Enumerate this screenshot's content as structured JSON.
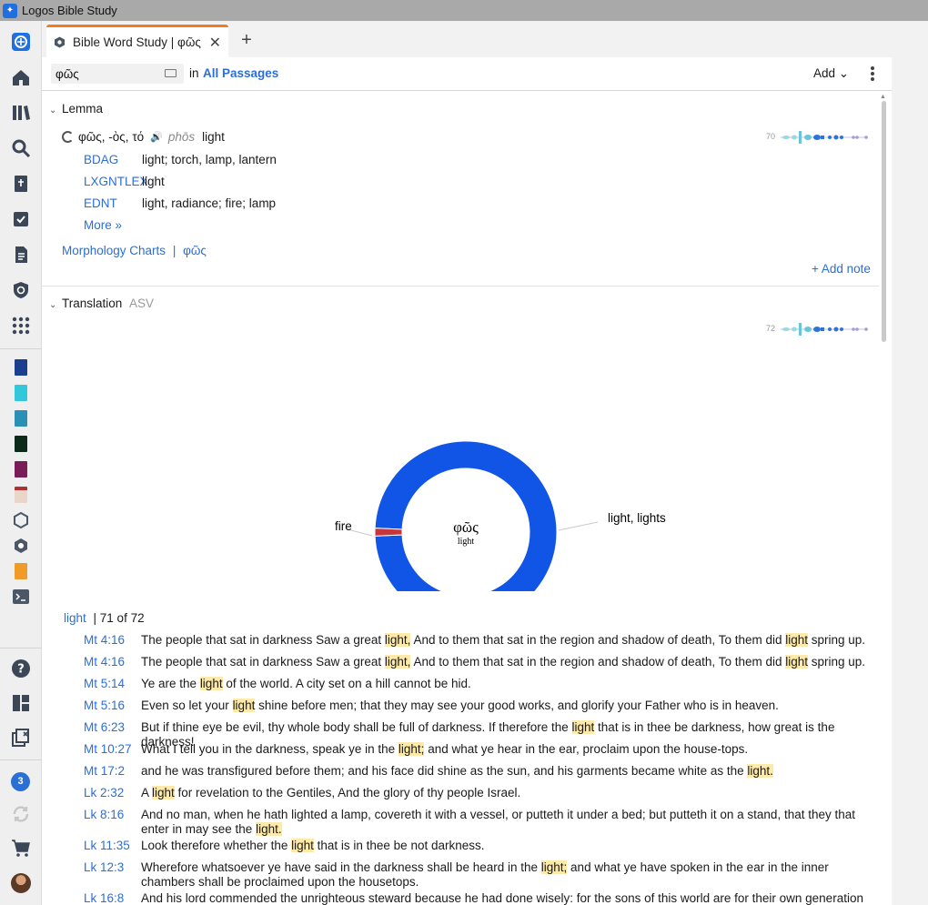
{
  "window": {
    "title": "Logos Bible Study"
  },
  "tabs": [
    {
      "label": "Bible Word Study | φῶς",
      "close": "✕"
    }
  ],
  "new_tab": "+",
  "toolbar": {
    "search_value": "φῶς",
    "in_label": "in",
    "passages_link": "All Passages",
    "add_label": "Add ⌄"
  },
  "lemma_section": {
    "title": "Lemma",
    "lemma": "φῶς, -ὸς, τό",
    "transliteration": "phōs",
    "gloss": "light",
    "sparkline_count": "70",
    "lexicons": [
      {
        "abbr": "BDAG",
        "def": "light; torch, lamp, lantern"
      },
      {
        "abbr": "LXGNTLEX",
        "def": "light"
      },
      {
        "abbr": "EDNT",
        "def": "light, radiance; fire; lamp"
      }
    ],
    "more_link": "More »",
    "morph_link": "Morphology Charts",
    "morph_sep": "|",
    "morph_word": "φῶς",
    "add_note": "+ Add note"
  },
  "translation_section": {
    "title": "Translation",
    "version": "ASV",
    "sparkline_count": "72"
  },
  "chart_data": {
    "type": "pie",
    "style": "donut",
    "center_label": "φῶς",
    "center_sublabel": "light",
    "slices": [
      {
        "label": "light, lights",
        "value": 71,
        "color": "#1055e6"
      },
      {
        "label": "fire",
        "value": 1,
        "color": "#c7363b"
      }
    ]
  },
  "results": {
    "term": "light",
    "count_text": "| 71 of 72",
    "verses": [
      {
        "ref": "Mt 4:16",
        "parts": [
          "The people that sat in darkness Saw a great ",
          "light,",
          " And to them that sat in the region and shadow of death, To them did ",
          "light",
          " spring up."
        ]
      },
      {
        "ref": "Mt 4:16",
        "parts": [
          "The people that sat in darkness Saw a great ",
          "light,",
          " And to them that sat in the region and shadow of death, To them did ",
          "light",
          " spring up."
        ]
      },
      {
        "ref": "Mt 5:14",
        "parts": [
          "Ye are the ",
          "light",
          " of the world. A city set on a hill cannot be hid."
        ]
      },
      {
        "ref": "Mt 5:16",
        "parts": [
          "Even so let your ",
          "light",
          " shine before men; that they may see your good works, and glorify your Father who is in heaven."
        ]
      },
      {
        "ref": "Mt 6:23",
        "parts": [
          "But if thine eye be evil, thy whole body shall be full of darkness. If therefore the ",
          "light",
          " that is in thee be darkness, how great is the darkness!"
        ]
      },
      {
        "ref": "Mt 10:27",
        "parts": [
          "What I tell you in the darkness, speak ye in the ",
          "light;",
          " and what ye hear in the ear, proclaim upon the house-tops."
        ]
      },
      {
        "ref": "Mt 17:2",
        "parts": [
          "and he was transfigured before them; and his face did shine as the sun, and his garments became white as the ",
          "light."
        ]
      },
      {
        "ref": "Lk 2:32",
        "parts": [
          "A ",
          "light",
          " for revelation to the Gentiles, And the glory of thy people Israel."
        ]
      },
      {
        "ref": "Lk 8:16",
        "parts": [
          "And no man, when he hath lighted a lamp, covereth it with a vessel, or putteth it under a bed; but putteth it on a stand, that they that enter in may see the ",
          "light."
        ]
      },
      {
        "ref": "Lk 11:35",
        "parts": [
          "Look therefore whether the ",
          "light",
          " that is in thee be not darkness."
        ]
      },
      {
        "ref": "Lk 12:3",
        "parts": [
          "Wherefore whatsoever ye have said in the darkness shall be heard in the ",
          "light;",
          " and what ye have spoken in the ear in the inner chambers shall be proclaimed upon the housetops."
        ]
      },
      {
        "ref": "Lk 16:8",
        "parts": [
          "And his lord commended the unrighteous steward because he had done wisely: for the sons of this world are for their own generation"
        ]
      }
    ]
  },
  "rail": {
    "notification_count": "3"
  }
}
